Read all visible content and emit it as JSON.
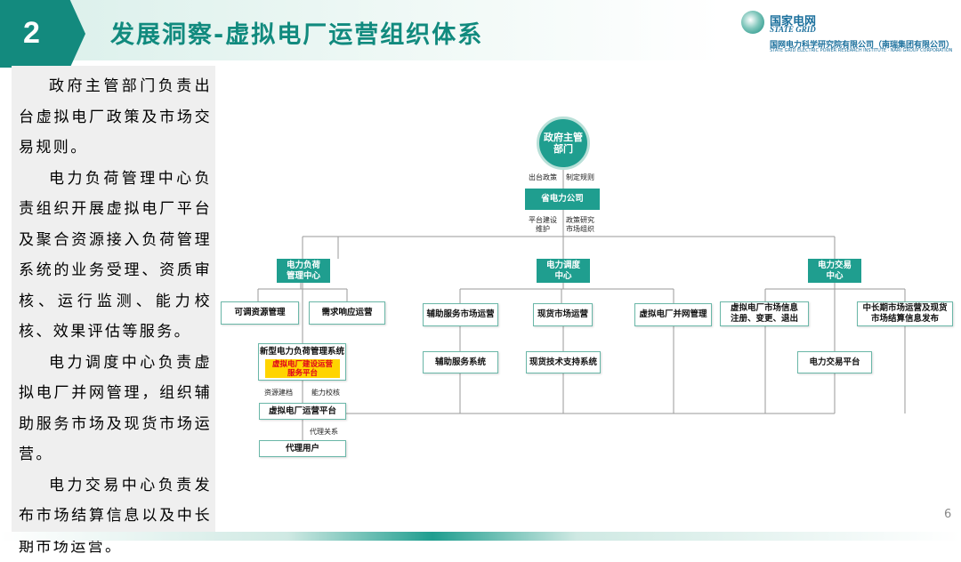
{
  "header": {
    "section_number": "2",
    "title": "发展洞察-虚拟电厂运营组织体系",
    "logo": {
      "name_cn": "国家电网",
      "name_en": "STATE GRID",
      "org_cn": "国网电力科学研究院有限公司（南瑞集团有限公司）",
      "org_en": "STATE GRID ELECTRIC POWER RESEARCH INSTITUTE · NARI GROUP CORPORATION"
    }
  },
  "left_panel": {
    "paragraphs": [
      "政府主管部门负责出台虚拟电厂政策及市场交易规则。",
      "电力负荷管理中心负责组织开展虚拟电厂平台及聚合资源接入负荷管理系统的业务受理、资质审核、运行监测、能力校核、效果评估等服务。",
      "电力调度中心负责虚拟电厂并网管理，组织辅助服务市场及现货市场运营。",
      "电力交易中心负责发布市场结算信息以及中长期市场运营。"
    ]
  },
  "diagram": {
    "gov": "政府主管\n部门",
    "gov_label_left": "出台政策",
    "gov_label_right": "制定规则",
    "province": "省电力公司",
    "prov_label_left": "平台建设\n维护",
    "prov_label_right": "政策研究\n市场组织",
    "load_center": "电力负荷\n管理中心",
    "dispatch_center": "电力调度\n中心",
    "trade_center": "电力交易\n中心",
    "adjustable_ops": "可调资源管理",
    "demand_response": "需求响应运营",
    "new_load_system": "新型电力负荷管理系统",
    "vpp_platform_highlight": "虚拟电厂建设运营\n服务平台",
    "label_resource_modeling": "资源建档",
    "label_capacity_check": "能力校核",
    "vpp_ops_platform": "虚拟电厂运营平台",
    "label_agency": "代理关系",
    "agent_user": "代理用户",
    "ancillary_ops": "辅助服务市场运营",
    "spot_ops": "现货市场运营",
    "vpp_grid_mgmt": "虚拟电厂并网管理",
    "ancillary_system": "辅助服务系统",
    "spot_tech_system": "现货技术支持系统",
    "vpp_market_info": "虚拟电厂市场信息\n注册、变更、退出",
    "mid_long_term": "中长期市场运营及现货\n市场结算信息发布",
    "trade_platform": "电力交易平台"
  },
  "page_number": "6",
  "colors": {
    "primary": "#138a7e",
    "accent": "#1f9e8f",
    "highlight": "#ffd400",
    "highlight_text": "#e0001b"
  }
}
